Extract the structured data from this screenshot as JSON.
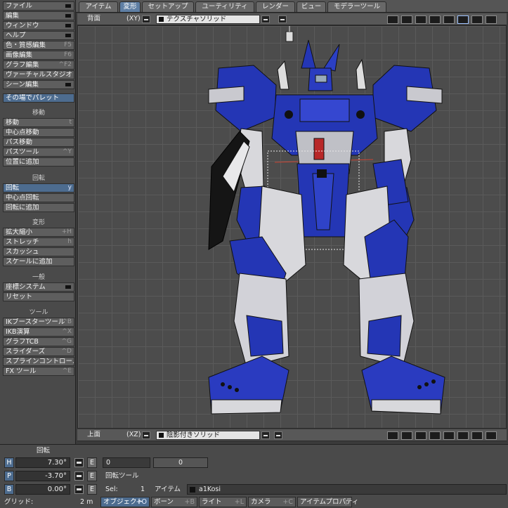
{
  "menu": [
    {
      "label": "ファイル",
      "shortcut": "",
      "dropdown": true
    },
    {
      "label": "編集",
      "shortcut": "",
      "dropdown": true
    },
    {
      "label": "ウィンドウ",
      "shortcut": "",
      "dropdown": true
    },
    {
      "label": "ヘルプ",
      "shortcut": "",
      "dropdown": true
    },
    {
      "label": "色・質感編集",
      "shortcut": "F5",
      "dropdown": false
    },
    {
      "label": "画像編集",
      "shortcut": "F6",
      "dropdown": false
    },
    {
      "label": "グラフ編集",
      "shortcut": "^F2",
      "dropdown": false
    },
    {
      "label": "ヴァーチャルスタジオ",
      "shortcut": "",
      "dropdown": false
    },
    {
      "label": "シーン編集",
      "shortcut": "",
      "dropdown": true
    }
  ],
  "palette_button": "その場でパレット",
  "sections": {
    "move": {
      "title": "移動",
      "items": [
        {
          "label": "移動",
          "shortcut": "t",
          "active": false
        },
        {
          "label": "中心点移動",
          "shortcut": "",
          "active": false
        },
        {
          "label": "パス移動",
          "shortcut": "",
          "active": false
        },
        {
          "label": "パスツール",
          "shortcut": "^Y",
          "active": false
        },
        {
          "label": "位置に追加",
          "shortcut": "",
          "active": false
        }
      ]
    },
    "rotate": {
      "title": "回転",
      "items": [
        {
          "label": "回転",
          "shortcut": "y",
          "active": true
        },
        {
          "label": "中心点回転",
          "shortcut": "",
          "active": false
        },
        {
          "label": "回転に追加",
          "shortcut": "",
          "active": false
        }
      ]
    },
    "deform": {
      "title": "変形",
      "items": [
        {
          "label": "拡大縮小",
          "shortcut": "+H",
          "active": false
        },
        {
          "label": "ストレッチ",
          "shortcut": "h",
          "active": false
        },
        {
          "label": "スカッシュ",
          "shortcut": "",
          "active": false
        },
        {
          "label": "スケールに追加",
          "shortcut": "",
          "active": false
        }
      ]
    },
    "general": {
      "title": "一般",
      "items": [
        {
          "label": "座標システム",
          "shortcut": "",
          "active": false,
          "dropdown": true
        },
        {
          "label": "リセット",
          "shortcut": "",
          "active": false
        }
      ]
    },
    "tools": {
      "title": "ツール",
      "items": [
        {
          "label": "IKブースターツール",
          "shortcut": "^B",
          "active": false
        },
        {
          "label": "IKB演算",
          "shortcut": "^X",
          "active": false
        },
        {
          "label": "グラフTCB",
          "shortcut": "^G",
          "active": false
        },
        {
          "label": "スライダーズ",
          "shortcut": "^D",
          "active": false
        },
        {
          "label": "スプラインコントロール",
          "shortcut": "",
          "active": false
        },
        {
          "label": "FX ツール",
          "shortcut": "^E",
          "active": false
        }
      ]
    }
  },
  "tabs": [
    {
      "label": "アイテム",
      "active": false
    },
    {
      "label": "変形",
      "active": true
    },
    {
      "label": "セットアップ",
      "active": false
    },
    {
      "label": "ユーティリティ",
      "active": false
    },
    {
      "label": "レンダー",
      "active": false
    },
    {
      "label": "ビュー",
      "active": false
    },
    {
      "label": "モデラーツール",
      "active": false
    }
  ],
  "viewport_top": {
    "view": "背面",
    "axes": "(XY)",
    "shading": "テクスチャソリッド"
  },
  "viewport_bottom": {
    "view": "上面",
    "axes": "(XZ)",
    "shading": "陰影付きソリッド"
  },
  "bottom": {
    "rotation_label": "回転",
    "h": {
      "axis": "H",
      "value": "7.30°"
    },
    "p": {
      "axis": "P",
      "value": "-3.70°"
    },
    "b": {
      "axis": "B",
      "value": "0.00°"
    },
    "e_label": "E",
    "field_value": "0",
    "slider_value": "0",
    "tool_name": "回転ツール",
    "sel_label": "Sel:",
    "sel_count": "1",
    "item_label": "アイテム",
    "item_name": "a1Kosi",
    "grid_label": "グリッド:",
    "grid_value": "2 m",
    "modes": [
      {
        "label": "オブジェクト",
        "shortcut": "+O",
        "active": true
      },
      {
        "label": "ボーン",
        "shortcut": "+B",
        "active": false
      },
      {
        "label": "ライト",
        "shortcut": "+L",
        "active": false
      },
      {
        "label": "カメラ",
        "shortcut": "+C",
        "active": false
      }
    ],
    "properties": "アイテムプロパティ",
    "properties_shortcut": "p"
  },
  "colors": {
    "accent": "#4d6c8f",
    "tab_active": "#5f7fa4",
    "robot_blue": "#2436b5",
    "robot_white": "#d8d8dc"
  }
}
